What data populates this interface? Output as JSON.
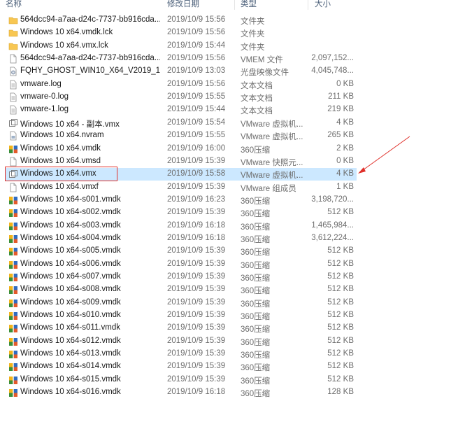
{
  "columns": {
    "name": "名称",
    "date": "修改日期",
    "type": "类型",
    "size": "大小"
  },
  "files": [
    {
      "name": "564dcc94-a7aa-d24c-7737-bb916cda...",
      "date": "2019/10/9 15:56",
      "type": "文件夹",
      "size": "",
      "icon": "folder-icon"
    },
    {
      "name": "Windows 10 x64.vmdk.lck",
      "date": "2019/10/9 15:56",
      "type": "文件夹",
      "size": "",
      "icon": "folder-icon"
    },
    {
      "name": "Windows 10 x64.vmx.lck",
      "date": "2019/10/9 15:44",
      "type": "文件夹",
      "size": "",
      "icon": "folder-icon"
    },
    {
      "name": "564dcc94-a7aa-d24c-7737-bb916cda...",
      "date": "2019/10/9 15:56",
      "type": "VMEM 文件",
      "size": "2,097,152...",
      "icon": "blank-file-icon"
    },
    {
      "name": "FQHY_GHOST_WIN10_X64_V2019_10.i...",
      "date": "2019/10/9 13:03",
      "type": "光盘映像文件",
      "size": "4,045,748...",
      "icon": "disc-image-icon"
    },
    {
      "name": "vmware.log",
      "date": "2019/10/9 15:56",
      "type": "文本文档",
      "size": "0 KB",
      "icon": "text-file-icon"
    },
    {
      "name": "vmware-0.log",
      "date": "2019/10/9 15:55",
      "type": "文本文档",
      "size": "211 KB",
      "icon": "text-file-icon"
    },
    {
      "name": "vmware-1.log",
      "date": "2019/10/9 15:44",
      "type": "文本文档",
      "size": "219 KB",
      "icon": "text-file-icon"
    },
    {
      "name": "Windows 10 x64 - 副本.vmx",
      "date": "2019/10/9 15:54",
      "type": "VMware 虚拟机...",
      "size": "4 KB",
      "icon": "vmware-vm-icon"
    },
    {
      "name": "Windows 10 x64.nvram",
      "date": "2019/10/9 15:55",
      "type": "VMware 虚拟机...",
      "size": "265 KB",
      "icon": "vmware-nvram-icon"
    },
    {
      "name": "Windows 10 x64.vmdk",
      "date": "2019/10/9 16:00",
      "type": "360压缩",
      "size": "2 KB",
      "icon": "archive-icon"
    },
    {
      "name": "Windows 10 x64.vmsd",
      "date": "2019/10/9 15:39",
      "type": "VMware 快照元...",
      "size": "0 KB",
      "icon": "vmware-snapshot-icon"
    },
    {
      "name": "Windows 10 x64.vmx",
      "date": "2019/10/9 15:58",
      "type": "VMware 虚拟机...",
      "size": "4 KB",
      "icon": "vmware-vm-icon",
      "selected": true
    },
    {
      "name": "Windows 10 x64.vmxf",
      "date": "2019/10/9 15:39",
      "type": "VMware 组成员",
      "size": "1 KB",
      "icon": "vmware-team-icon"
    },
    {
      "name": "Windows 10 x64-s001.vmdk",
      "date": "2019/10/9 16:23",
      "type": "360压缩",
      "size": "3,198,720...",
      "icon": "archive-icon"
    },
    {
      "name": "Windows 10 x64-s002.vmdk",
      "date": "2019/10/9 15:39",
      "type": "360压缩",
      "size": "512 KB",
      "icon": "archive-icon"
    },
    {
      "name": "Windows 10 x64-s003.vmdk",
      "date": "2019/10/9 16:18",
      "type": "360压缩",
      "size": "1,465,984...",
      "icon": "archive-icon"
    },
    {
      "name": "Windows 10 x64-s004.vmdk",
      "date": "2019/10/9 16:18",
      "type": "360压缩",
      "size": "3,612,224...",
      "icon": "archive-icon"
    },
    {
      "name": "Windows 10 x64-s005.vmdk",
      "date": "2019/10/9 15:39",
      "type": "360压缩",
      "size": "512 KB",
      "icon": "archive-icon"
    },
    {
      "name": "Windows 10 x64-s006.vmdk",
      "date": "2019/10/9 15:39",
      "type": "360压缩",
      "size": "512 KB",
      "icon": "archive-icon"
    },
    {
      "name": "Windows 10 x64-s007.vmdk",
      "date": "2019/10/9 15:39",
      "type": "360压缩",
      "size": "512 KB",
      "icon": "archive-icon"
    },
    {
      "name": "Windows 10 x64-s008.vmdk",
      "date": "2019/10/9 15:39",
      "type": "360压缩",
      "size": "512 KB",
      "icon": "archive-icon"
    },
    {
      "name": "Windows 10 x64-s009.vmdk",
      "date": "2019/10/9 15:39",
      "type": "360压缩",
      "size": "512 KB",
      "icon": "archive-icon"
    },
    {
      "name": "Windows 10 x64-s010.vmdk",
      "date": "2019/10/9 15:39",
      "type": "360压缩",
      "size": "512 KB",
      "icon": "archive-icon"
    },
    {
      "name": "Windows 10 x64-s011.vmdk",
      "date": "2019/10/9 15:39",
      "type": "360压缩",
      "size": "512 KB",
      "icon": "archive-icon"
    },
    {
      "name": "Windows 10 x64-s012.vmdk",
      "date": "2019/10/9 15:39",
      "type": "360压缩",
      "size": "512 KB",
      "icon": "archive-icon"
    },
    {
      "name": "Windows 10 x64-s013.vmdk",
      "date": "2019/10/9 15:39",
      "type": "360压缩",
      "size": "512 KB",
      "icon": "archive-icon"
    },
    {
      "name": "Windows 10 x64-s014.vmdk",
      "date": "2019/10/9 15:39",
      "type": "360压缩",
      "size": "512 KB",
      "icon": "archive-icon"
    },
    {
      "name": "Windows 10 x64-s015.vmdk",
      "date": "2019/10/9 15:39",
      "type": "360压缩",
      "size": "512 KB",
      "icon": "archive-icon"
    },
    {
      "name": "Windows 10 x64-s016.vmdk",
      "date": "2019/10/9 16:18",
      "type": "360压缩",
      "size": "128 KB",
      "icon": "archive-icon"
    }
  ],
  "colors": {
    "selection": "#cce8ff",
    "annotation_red": "#e0302a",
    "header_text": "#4c607a"
  }
}
